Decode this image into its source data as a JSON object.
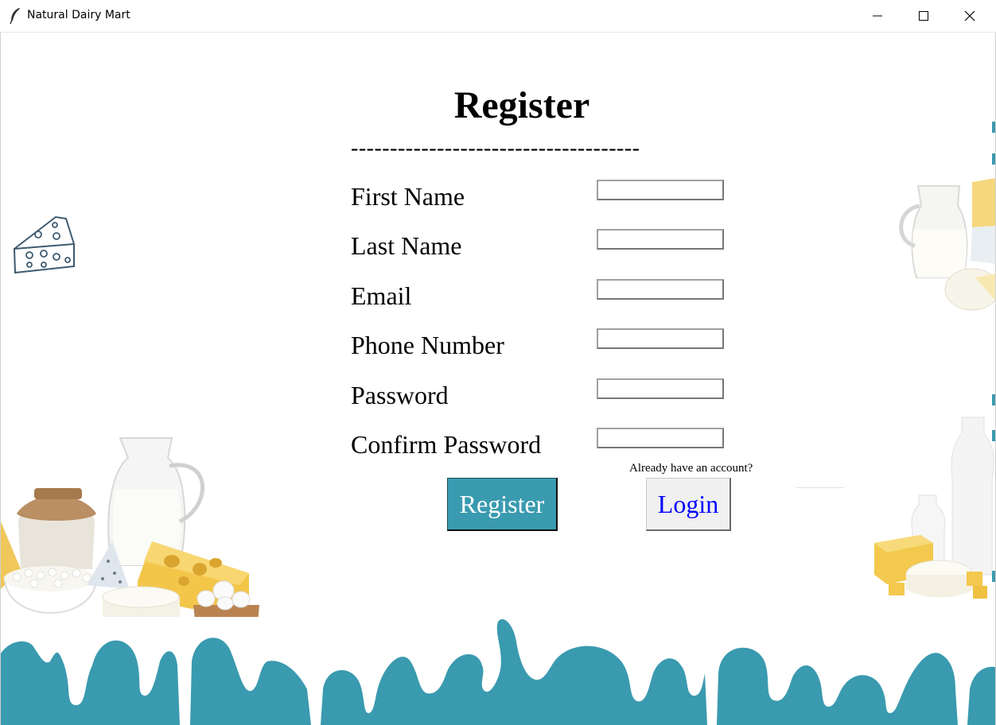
{
  "window": {
    "title": "Natural Dairy Mart",
    "controls": {
      "minimize": "minimize",
      "maximize": "maximize",
      "close": "close"
    }
  },
  "form": {
    "heading": "Register",
    "divider": "-------------------------------------",
    "fields": [
      {
        "label": "First Name",
        "value": ""
      },
      {
        "label": "Last Name",
        "value": ""
      },
      {
        "label": "Email",
        "value": ""
      },
      {
        "label": "Phone Number",
        "value": ""
      },
      {
        "label": "Password",
        "value": ""
      },
      {
        "label": "Confirm Password",
        "value": ""
      }
    ],
    "register_label": "Register",
    "login_hint": "Already have an account?",
    "login_label": "Login"
  },
  "colors": {
    "accent": "#3a9aaf",
    "login_text": "#0000ff",
    "background": "#ffffff"
  },
  "icons": [
    "feather-icon",
    "minimize-icon",
    "maximize-icon",
    "close-icon",
    "cheese-outline-icon"
  ]
}
